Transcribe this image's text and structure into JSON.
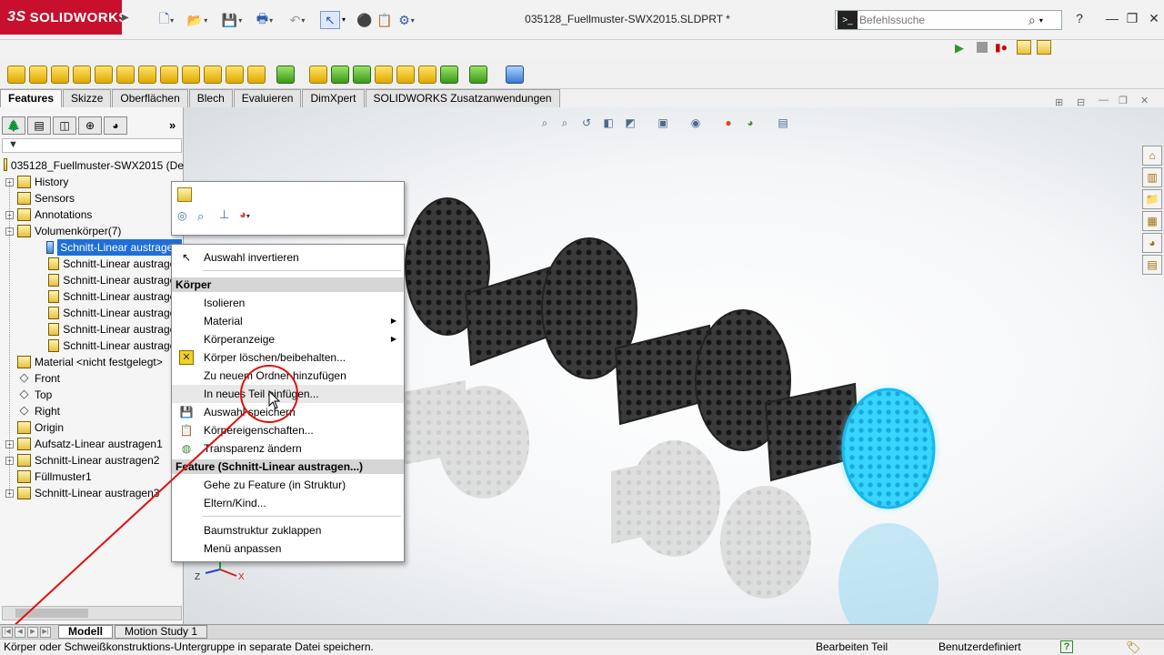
{
  "app": {
    "logo_prefix": "3S",
    "logo_text": "SOLIDWORKS",
    "document_title": "035128_Fuellmuster-SWX2015.SLDPRT *"
  },
  "search": {
    "placeholder": "Befehlssuche",
    "help_icon": "?"
  },
  "command_tabs": [
    "Features",
    "Skizze",
    "Oberflächen",
    "Blech",
    "Evaluieren",
    "DimXpert",
    "SOLIDWORKS Zusatzanwendungen"
  ],
  "tree": {
    "root": "035128_Fuellmuster-SWX2015  (De",
    "items": [
      {
        "label": "History",
        "exp": "+"
      },
      {
        "label": "Sensors",
        "exp": ""
      },
      {
        "label": "Annotations",
        "exp": "+"
      },
      {
        "label": "Volumenkörper(7)",
        "exp": "−"
      },
      {
        "label": "Schnitt-Linear austragen",
        "exp": "",
        "selected": true
      },
      {
        "label": "Schnitt-Linear austragen",
        "exp": ""
      },
      {
        "label": "Schnitt-Linear austragen",
        "exp": ""
      },
      {
        "label": "Schnitt-Linear austragen",
        "exp": ""
      },
      {
        "label": "Schnitt-Linear austragen",
        "exp": ""
      },
      {
        "label": "Schnitt-Linear austragen",
        "exp": ""
      },
      {
        "label": "Schnitt-Linear austragen",
        "exp": ""
      },
      {
        "label": "Material <nicht festgelegt>",
        "exp": ""
      },
      {
        "label": "Front",
        "exp": ""
      },
      {
        "label": "Top",
        "exp": ""
      },
      {
        "label": "Right",
        "exp": ""
      },
      {
        "label": "Origin",
        "exp": ""
      },
      {
        "label": "Aufsatz-Linear austragen1",
        "exp": "+"
      },
      {
        "label": "Schnitt-Linear austragen2",
        "exp": "+"
      },
      {
        "label": "Füllmuster1",
        "exp": ""
      },
      {
        "label": "Schnitt-Linear austragen3",
        "exp": "+"
      }
    ]
  },
  "context_menu": {
    "item_invert": "Auswahl invertieren",
    "header_body": "Körper",
    "isolate": "Isolieren",
    "material": "Material",
    "body_display": "Körperanzeige",
    "delete_keep": "Körper löschen/beibehalten...",
    "add_folder": "Zu neuem Ordner hinzufügen",
    "insert_part": "In neues Teil einfügen...",
    "save_selection": "Auswahl speichern",
    "body_props": "Körpereigenschaften...",
    "transparency": "Transparenz ändern",
    "header_feature": "Feature (Schnitt-Linear austragen...)",
    "goto_feature": "Gehe zu Feature (in Struktur)",
    "parent_child": "Eltern/Kind...",
    "collapse_tree": "Baumstruktur zuklappen",
    "customize_menu": "Menü anpassen"
  },
  "bottom_tabs": [
    "Modell",
    "Motion Study 1"
  ],
  "status": {
    "message": "Körper oder Schweißkonstruktions-Untergruppe in separate Datei speichern.",
    "mode": "Bearbeiten Teil",
    "units": "Benutzerdefiniert",
    "help_badge": "?"
  },
  "triad": {
    "z": "Z",
    "x": "X"
  },
  "colors": {
    "accent_red": "#c8102e",
    "selection_blue": "#1e6fd9",
    "highlight_body": "#29d0ff",
    "annotation_red": "#e01010"
  }
}
